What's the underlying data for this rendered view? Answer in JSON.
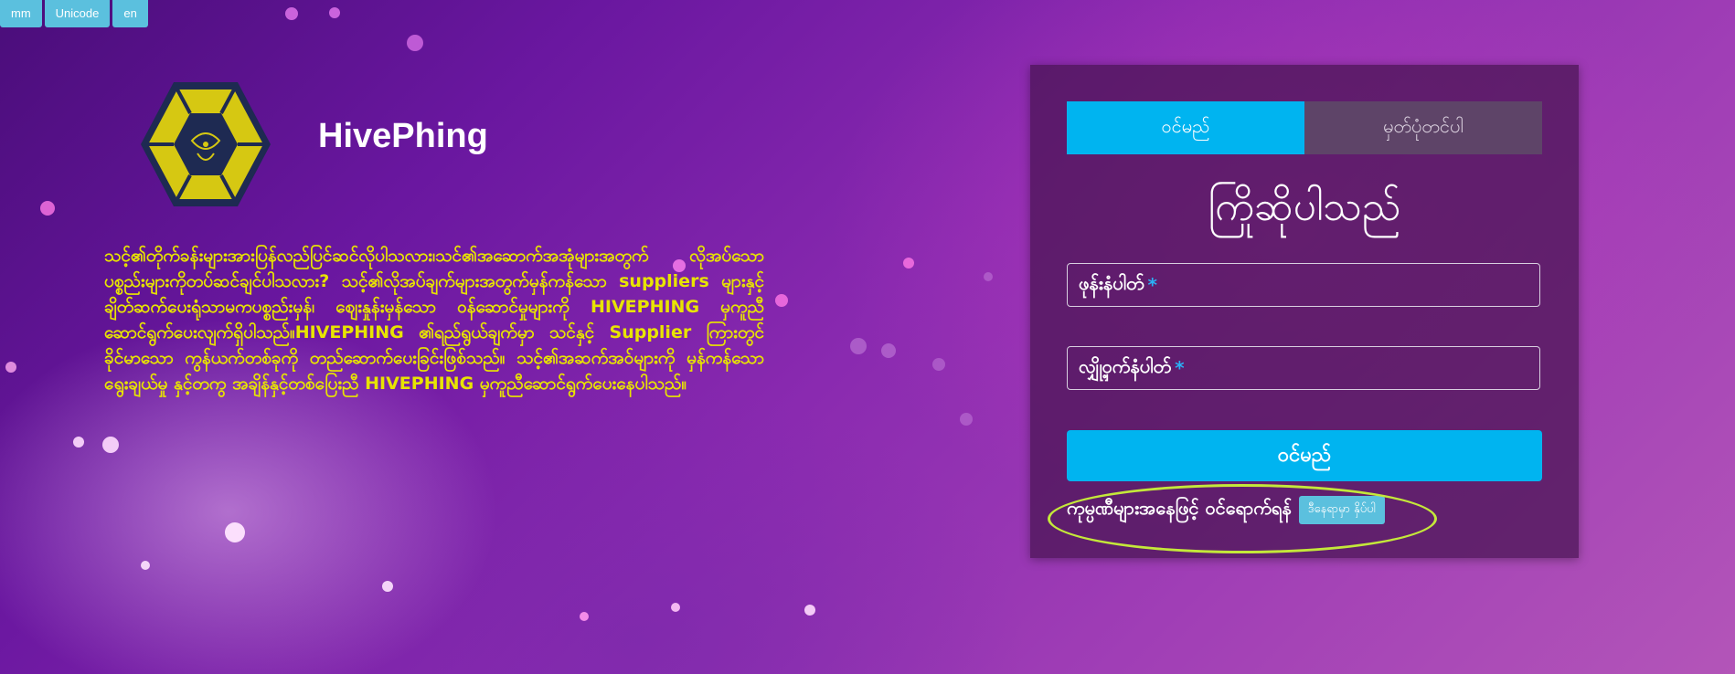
{
  "lang_bar": {
    "items": [
      "mm",
      "Unicode",
      "en"
    ]
  },
  "brand": {
    "name": "HivePhing"
  },
  "about": {
    "text": "သင့်၏တိုက်ခန်းများအားပြန်လည်ပြင်ဆင်လိုပါသလား၊သင်၏အဆောက်အအုံများအတွက် လိုအပ်သောပစ္စည်းများကိုတပ်ဆင်ချင်ပါသလား? သင့်၏လိုအပ်ချက်များအတွက်မှန်ကန်သော suppliers များနှင့် ချိတ်ဆက်ပေးရုံသာမကပစ္စည်းမှန်၊ စျေးနှုန်းမှန်သော ဝန်ဆောင်မှုများကို HIVEPHING မှကူညီဆောင်ရွက်ပေးလျက်ရှိပါသည်။HIVEPHING ၏ရည်ရွယ်ချက်မှာ သင်နှင့် Supplier ကြားတွင် ခိုင်မာသော ကွန်ယက်တစ်ခုကို တည်ဆောက်ပေးခြင်းဖြစ်သည်။ သင့်၏အဆက်အဝ်များကို မှန်ကန်သော ရွေးချယ်မှု နှင့်တကွ အချိန်နှင့်တစ်ပြေးညီ HIVEPHING မှကူညီဆောင်ရွက်ပေးနေပါသည်။"
  },
  "login_panel": {
    "tabs": {
      "login": "ဝင်မည်",
      "register": "မှတ်ပုံတင်ပါ"
    },
    "welcome": "ကြိုဆိုပါသည်",
    "phone_label": "ဖုန်းနံပါတ်",
    "password_label": "လျှို့ဝှက်နံပါတ်",
    "required_mark": "*",
    "submit_label": "ဝင်မည်",
    "social_text": "ကုမ္ပဏီများအနေဖြင့် ဝင်ရောက်ရန်",
    "social_button": "ဒီနေရာမှာ နှိပ်ပါ"
  },
  "colors": {
    "accent": "#00b4f0",
    "lang_button": "#5bc0de",
    "about_text": "#e8e400",
    "highlight_ring": "#c4e83a",
    "logo_yellow": "#d6c812",
    "logo_navy": "#1e2a52"
  }
}
